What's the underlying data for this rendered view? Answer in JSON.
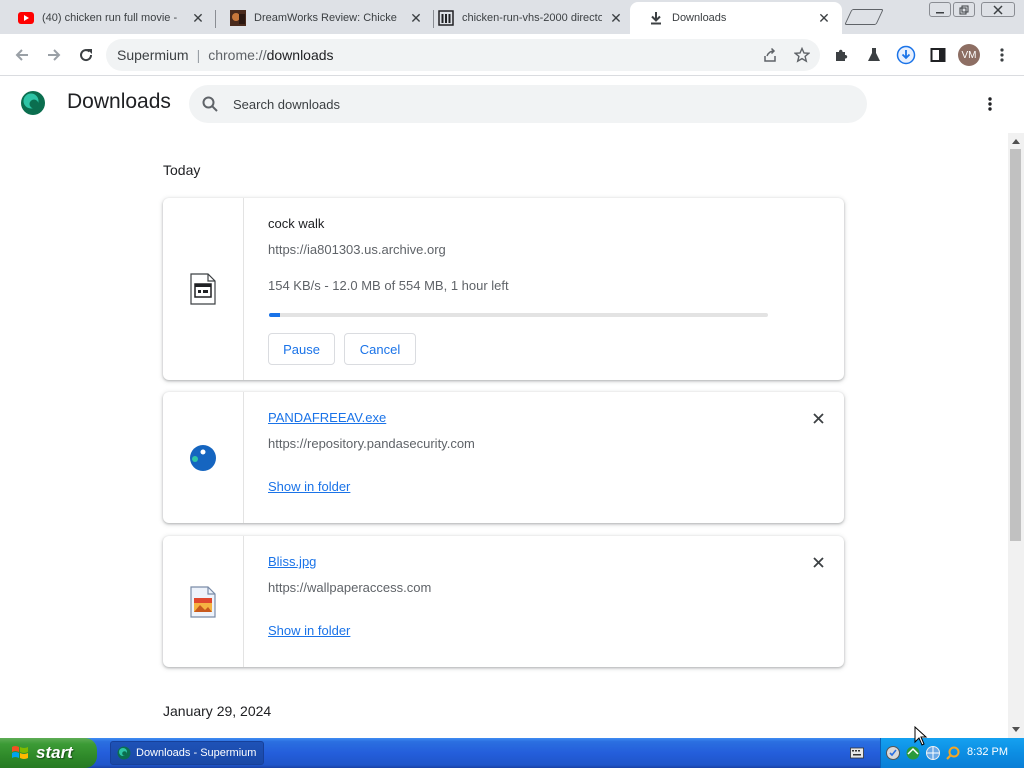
{
  "tabs": [
    {
      "title": "(40) chicken run full movie -",
      "favicon": "youtube-icon",
      "active": false
    },
    {
      "title": "DreamWorks Review: Chicke",
      "favicon": "movie-thumbnail-icon",
      "active": false
    },
    {
      "title": "chicken-run-vhs-2000 directo",
      "favicon": "archive-icon",
      "active": false
    },
    {
      "title": "Downloads",
      "favicon": "download-icon",
      "active": true
    }
  ],
  "omnibox": {
    "scheme": "Supermium",
    "url_dim": "chrome://",
    "url": "downloads"
  },
  "profile": {
    "initials": "VM"
  },
  "page": {
    "title": "Downloads",
    "search_placeholder": "Search downloads"
  },
  "sections": [
    {
      "date": "Today"
    },
    {
      "date": "January 29, 2024"
    }
  ],
  "downloads": [
    {
      "name": "cock walk",
      "source": "https://ia801303.us.archive.org",
      "status": "154 KB/s - 12.0 MB of 554 MB, 1 hour left",
      "progress": 0.022,
      "pause_label": "Pause",
      "cancel_label": "Cancel",
      "icon": "file-generic-icon"
    },
    {
      "name": "PANDAFREEAV.exe",
      "source": "https://repository.pandasecurity.com",
      "action": "Show in folder",
      "icon": "panda-icon"
    },
    {
      "name": "Bliss.jpg",
      "source": "https://wallpaperaccess.com",
      "action": "Show in folder",
      "icon": "image-file-icon"
    }
  ],
  "taskbar": {
    "start_label": "start",
    "task": "Downloads - Supermium",
    "clock": "8:32 PM"
  },
  "colors": {
    "accent": "#1a73e8",
    "taskbar": "#245edb",
    "start": "#3c9b36"
  }
}
